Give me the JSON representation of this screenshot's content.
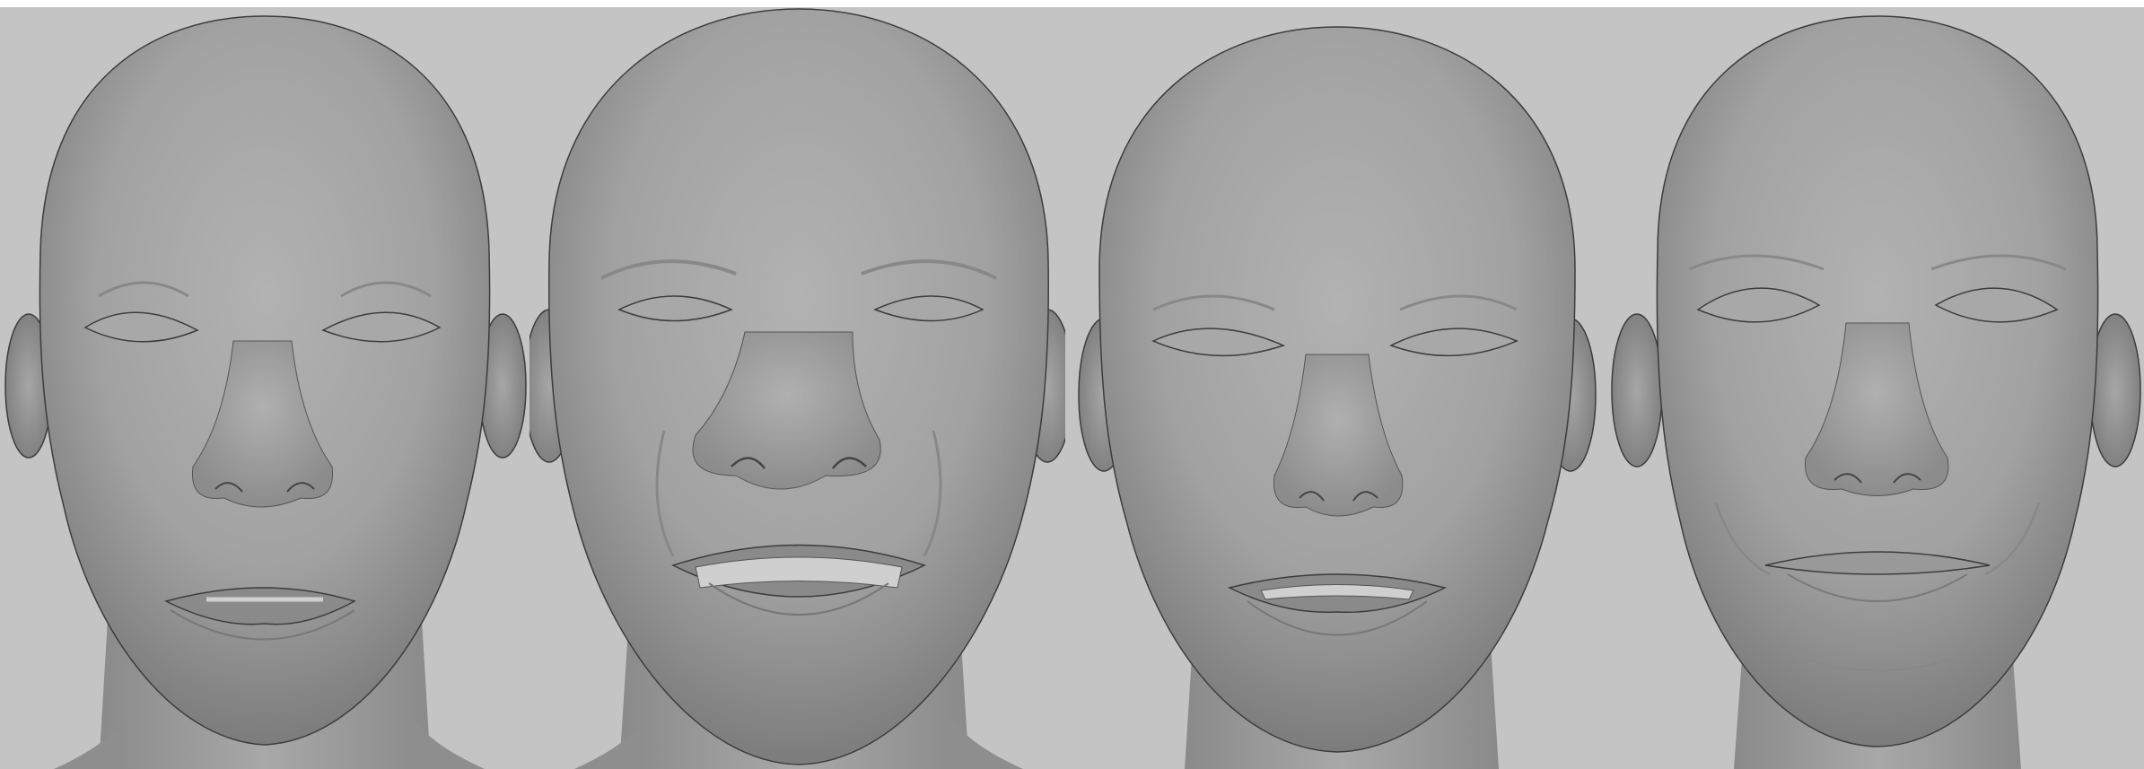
{
  "scene": {
    "description_visible_text": "",
    "colors": {
      "background": "#c4c4c4",
      "top_strip": "#ffffff",
      "skin_light": "#b4b4b4",
      "skin_mid": "#9e9e9e",
      "skin_dark": "#6e6e6e",
      "outline": "#3c3c3c"
    },
    "faces": [
      {
        "id": "face-1",
        "expression": "neutral-open-mouth"
      },
      {
        "id": "face-2",
        "expression": "smile-teeth"
      },
      {
        "id": "face-3",
        "expression": "slight-smile"
      },
      {
        "id": "face-4",
        "expression": "neutral-closed"
      }
    ]
  }
}
